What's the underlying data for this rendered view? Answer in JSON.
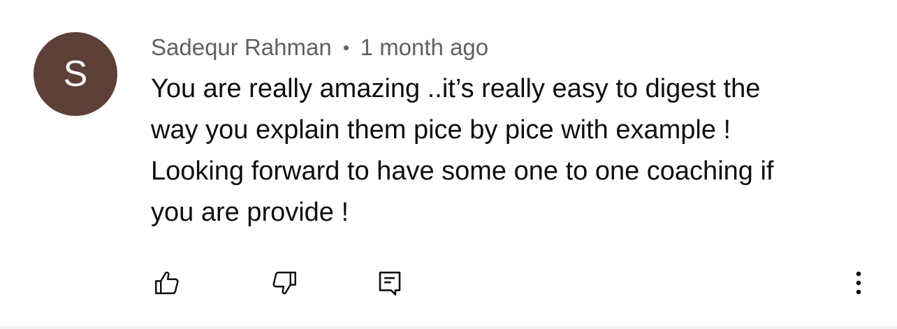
{
  "comment": {
    "avatar_letter": "S",
    "avatar_color": "#5d4037",
    "author": "Sadequr Rahman",
    "separator": "•",
    "timestamp": "1 month ago",
    "text": "You are really amazing ..it’s really easy to digest the\nway you explain them pice by pice with example !\nLooking forward to have some one to one coaching if\nyou are provide !"
  },
  "actions": {
    "like_icon": "thumbs-up-icon",
    "dislike_icon": "thumbs-down-icon",
    "reply_icon": "reply-comment-icon",
    "more_icon": "more-vertical-icon"
  }
}
